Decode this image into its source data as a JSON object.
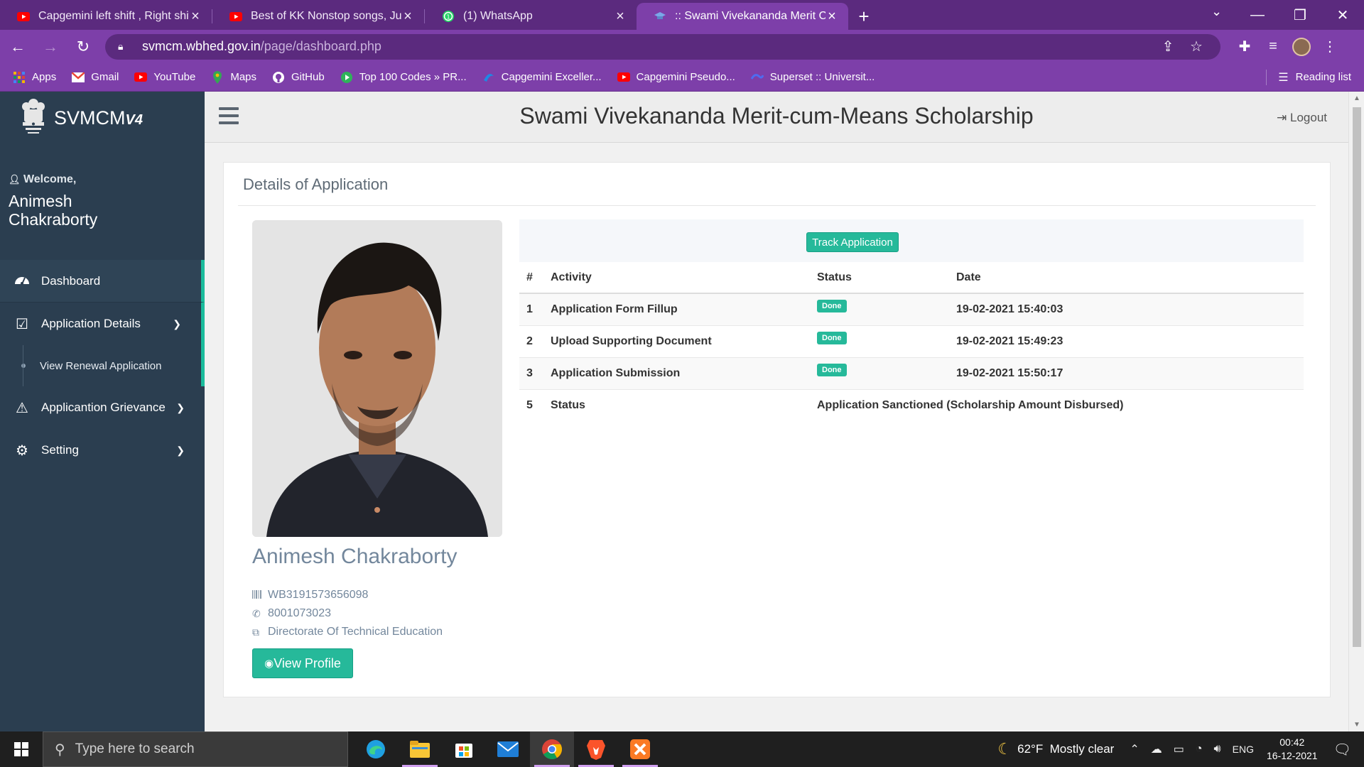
{
  "browser": {
    "tabs": [
      {
        "title": "Capgemini left shift , Right shift ,",
        "icon": "youtube-icon",
        "active": false
      },
      {
        "title": "Best of KK Nonstop songs, Jukeb",
        "icon": "youtube-icon",
        "active": false
      },
      {
        "title": "(1) WhatsApp",
        "icon": "whatsapp-icon",
        "active": false
      },
      {
        "title": ":: Swami Vivekananda Merit Cum",
        "icon": "scholarship-icon",
        "active": true
      }
    ],
    "url_host": "svmcm.wbhed.gov.in",
    "url_path": "/page/dashboard.php",
    "bookmarks": [
      {
        "label": "Apps",
        "icon": "apps-grid-icon"
      },
      {
        "label": "Gmail",
        "icon": "gmail-icon"
      },
      {
        "label": "YouTube",
        "icon": "youtube-icon"
      },
      {
        "label": "Maps",
        "icon": "maps-icon"
      },
      {
        "label": "GitHub",
        "icon": "github-icon"
      },
      {
        "label": "Top 100 Codes » PR...",
        "icon": "play-icon"
      },
      {
        "label": "Capgemini Exceller...",
        "icon": "capgemini-icon"
      },
      {
        "label": "Capgemini Pseudo...",
        "icon": "youtube-icon"
      },
      {
        "label": "Superset :: Universit...",
        "icon": "superset-icon"
      }
    ],
    "reading_list": "Reading list"
  },
  "sidebar": {
    "brand": "SVMCM",
    "brand_version": "V4",
    "welcome": "Welcome,",
    "user_name": "Animesh Chakraborty",
    "menu": [
      {
        "label": "Dashboard",
        "icon": "dashboard-gauge-icon"
      },
      {
        "label": "Application Details",
        "icon": "checkbox-icon"
      },
      {
        "label": "View Renewal Application"
      },
      {
        "label": "Applicantion Grievance",
        "icon": "warning-icon"
      },
      {
        "label": "Setting",
        "icon": "gear-icon"
      }
    ]
  },
  "header": {
    "title": "Swami Vivekananda Merit-cum-Means Scholarship",
    "logout": "Logout"
  },
  "card": {
    "title": "Details of Application",
    "profile": {
      "name": "Animesh Chakraborty",
      "application_id": "WB3191573656098",
      "phone": "8001073023",
      "department": "Directorate Of Technical Education",
      "view_profile": "View Profile"
    },
    "track_button": "Track Application",
    "table": {
      "headers": [
        "#",
        "Activity",
        "Status",
        "Date"
      ],
      "rows": [
        {
          "no": "1",
          "activity": "Application Form Fillup",
          "status": "Done",
          "date": "19-02-2021 15:40:03"
        },
        {
          "no": "2",
          "activity": "Upload Supporting Document",
          "status": "Done",
          "date": "19-02-2021 15:49:23"
        },
        {
          "no": "3",
          "activity": "Application Submission",
          "status": "Done",
          "date": "19-02-2021 15:50:17"
        }
      ],
      "final": {
        "no": "5",
        "activity": "Status",
        "value": "Application Sanctioned (Scholarship Amount Disbursed)"
      }
    }
  },
  "taskbar": {
    "search_placeholder": "Type here to search",
    "weather": "62°F  Mostly clear",
    "language": "ENG",
    "time": "00:42",
    "date": "16-12-2021"
  },
  "colors": {
    "browser_frame": "#5b2a7e",
    "browser_toolbar": "#7d3fa9",
    "sidebar": "#2b3e50",
    "accent": "#26b99a"
  }
}
